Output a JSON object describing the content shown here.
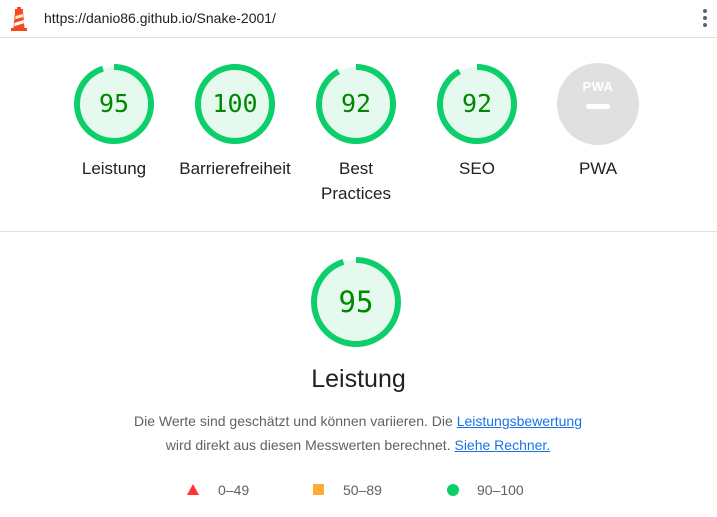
{
  "header": {
    "url": "https://danio86.github.io/Snake-2001/",
    "logo_icon": "lighthouse-icon",
    "menu_icon": "more-vertical-icon"
  },
  "gauges": [
    {
      "score": "95",
      "label": "Leistung",
      "value": 95
    },
    {
      "score": "100",
      "label": "Barrierefreiheit",
      "value": 100
    },
    {
      "score": "92",
      "label": "Best Practices",
      "value": 92
    },
    {
      "score": "92",
      "label": "SEO",
      "value": 92
    },
    {
      "label": "PWA",
      "badge_text": "PWA"
    }
  ],
  "detail": {
    "score": "95",
    "value": 95,
    "title": "Leistung",
    "desc_text_1": "Die Werte sind geschätzt und können variieren. Die ",
    "desc_link_1": "Leistungsbewertung",
    "desc_text_2": "wird direkt aus diesen Messwerten berechnet. ",
    "desc_link_2": "Siehe Rechner."
  },
  "legend": [
    {
      "range": "0–49",
      "icon": "red-triangle-icon"
    },
    {
      "range": "50–89",
      "icon": "orange-square-icon"
    },
    {
      "range": "90–100",
      "icon": "green-circle-icon"
    }
  ],
  "colors": {
    "pass": "#0cce6b",
    "pass_text": "#008800",
    "pass_fill": "#e6f9ee",
    "average": "#ffaa33",
    "fail": "#ff3333",
    "link": "#1a73e8",
    "pwa_gray": "#e0e0e0"
  }
}
